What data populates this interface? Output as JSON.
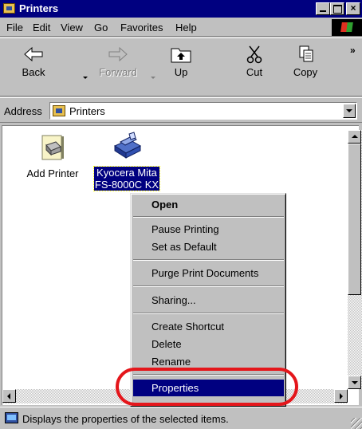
{
  "window": {
    "title": "Printers",
    "icon": "printers-folder-icon"
  },
  "menu": [
    "File",
    "Edit",
    "View",
    "Go",
    "Favorites",
    "Help"
  ],
  "toolbar": {
    "back": "Back",
    "forward": "Forward",
    "up": "Up",
    "cut": "Cut",
    "copy": "Copy",
    "more": "»"
  },
  "address": {
    "label": "Address",
    "value": "Printers"
  },
  "items": [
    {
      "label": "Add Printer",
      "icon": "add-printer-icon",
      "selected": false
    },
    {
      "label": "Kyocera Mita FS-8000C KX",
      "line1": "Kyocera Mita",
      "line2": "FS-8000C KX",
      "icon": "printer-icon",
      "selected": true
    }
  ],
  "context_menu": {
    "open": "Open",
    "pause": "Pause Printing",
    "set_default": "Set as Default",
    "purge": "Purge Print Documents",
    "sharing": "Sharing...",
    "create_shortcut": "Create Shortcut",
    "delete": "Delete",
    "rename": "Rename",
    "properties": "Properties"
  },
  "status": {
    "text": "Displays the properties of the selected items."
  },
  "colors": {
    "titlebar": "#000080",
    "highlight": "#000080",
    "face": "#c0c0c0",
    "annotation": "#e4161b"
  }
}
